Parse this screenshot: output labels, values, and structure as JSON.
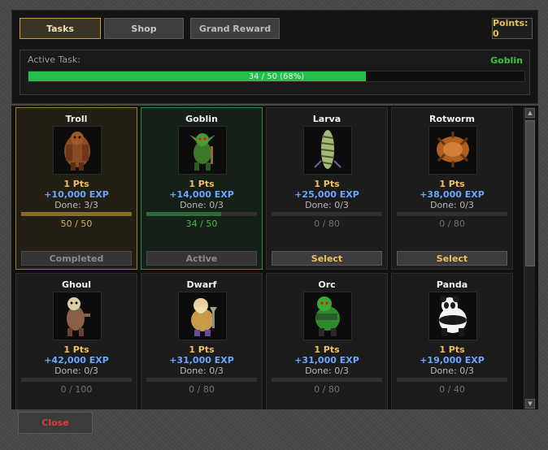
{
  "tabs": [
    {
      "label": "Tasks",
      "active": true
    },
    {
      "label": "Shop",
      "active": false
    },
    {
      "label": "Grand Reward",
      "active": false
    }
  ],
  "points": "Points: 0",
  "active_task": {
    "label": "Active Task:",
    "name": "Goblin",
    "progress_text": "34 / 50 (68%)",
    "progress": 0.68
  },
  "cards": [
    {
      "name": "Troll",
      "pts": "1 Pts",
      "exp": "+10,000 EXP",
      "done": "Done: 3/3",
      "progress_text": "50 / 50",
      "progress": 1.0,
      "state": "completed",
      "button": "Completed",
      "icon": "troll-icon"
    },
    {
      "name": "Goblin",
      "pts": "1 Pts",
      "exp": "+14,000 EXP",
      "done": "Done: 0/3",
      "progress_text": "34 / 50",
      "progress": 0.68,
      "state": "active",
      "button": "Active",
      "icon": "goblin-icon"
    },
    {
      "name": "Larva",
      "pts": "1 Pts",
      "exp": "+25,000 EXP",
      "done": "Done: 0/3",
      "progress_text": "0 / 80",
      "progress": 0,
      "state": "idle",
      "button": "Select",
      "icon": "larva-icon"
    },
    {
      "name": "Rotworm",
      "pts": "1 Pts",
      "exp": "+38,000 EXP",
      "done": "Done: 0/3",
      "progress_text": "0 / 80",
      "progress": 0,
      "state": "idle",
      "button": "Select",
      "icon": "rotworm-icon"
    },
    {
      "name": "Ghoul",
      "pts": "1 Pts",
      "exp": "+42,000 EXP",
      "done": "Done: 0/3",
      "progress_text": "0 / 100",
      "progress": 0,
      "state": "idle",
      "button": "",
      "icon": "ghoul-icon"
    },
    {
      "name": "Dwarf",
      "pts": "1 Pts",
      "exp": "+31,000 EXP",
      "done": "Done: 0/3",
      "progress_text": "0 / 80",
      "progress": 0,
      "state": "idle",
      "button": "",
      "icon": "dwarf-icon"
    },
    {
      "name": "Orc",
      "pts": "1 Pts",
      "exp": "+31,000 EXP",
      "done": "Done: 0/3",
      "progress_text": "0 / 80",
      "progress": 0,
      "state": "idle",
      "button": "",
      "icon": "orc-icon"
    },
    {
      "name": "Panda",
      "pts": "1 Pts",
      "exp": "+19,000 EXP",
      "done": "Done: 0/3",
      "progress_text": "0 / 40",
      "progress": 0,
      "state": "idle",
      "button": "",
      "icon": "panda-icon"
    }
  ],
  "close_label": "Close"
}
